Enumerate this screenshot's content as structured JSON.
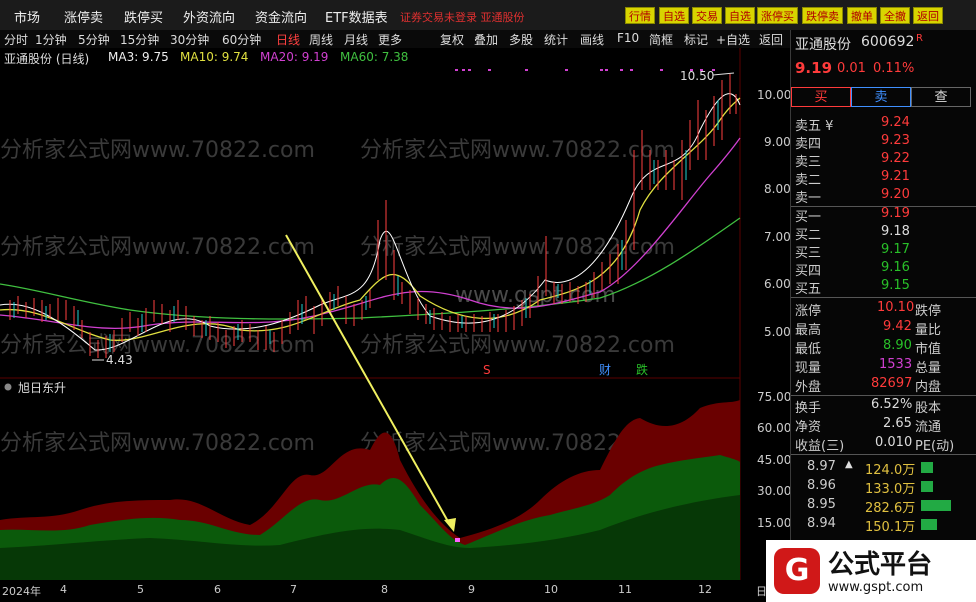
{
  "menu": [
    "市场",
    "涨停卖",
    "跌停买",
    "外资流向",
    "资金流向",
    "ETF数据表"
  ],
  "warn_text": "证券交易未登录  亚通股份",
  "top_buttons": [
    "行情",
    "自选",
    "交易",
    "自选",
    "涨停买",
    "跌停卖",
    "撤单",
    "全撤",
    "返回"
  ],
  "toolbar": {
    "periods": [
      "分时",
      "1分钟",
      "5分钟",
      "15分钟",
      "30分钟",
      "60分钟",
      "日线",
      "周线",
      "月线",
      "更多"
    ],
    "actions": [
      "复权",
      "叠加",
      "多股",
      "统计",
      "画线",
      "F10",
      "简框",
      "标记",
      "+自选",
      "返回"
    ]
  },
  "legend": {
    "title": "亚通股份 (日线)",
    "ma3": "MA3: 9.75",
    "ma10": "MA10: 9.74",
    "ma20": "MA20: 9.19",
    "ma60": "MA60: 7.38"
  },
  "price_axis": [
    "10.00",
    "9.00",
    "8.00",
    "7.00",
    "6.00",
    "5.00"
  ],
  "price_annotations": {
    "high": "10.50",
    "low": "4.43"
  },
  "event_marks": {
    "s": "S",
    "cai": "财",
    "die": "跌"
  },
  "watermark": "分析家公式网www.70822.com",
  "watermark2": "www.gspt.com",
  "indicator": {
    "name": "旭日东升",
    "axis": [
      "75.00",
      "60.00",
      "45.00",
      "30.00",
      "15.00"
    ]
  },
  "x_axis": {
    "year": "2024年",
    "months": [
      "4",
      "5",
      "6",
      "7",
      "8",
      "9",
      "10",
      "11",
      "12"
    ],
    "suffix": "日"
  },
  "stock": {
    "name": "亚通股份",
    "code": "600692",
    "flag": "R",
    "price": "9.19",
    "change": "0.01",
    "pct": "0.11%"
  },
  "trade_buttons": {
    "buy": "买",
    "sell": "卖",
    "query": "查"
  },
  "order_book": {
    "asks": [
      {
        "l": "卖五 ¥",
        "v": "9.24"
      },
      {
        "l": "卖四",
        "v": "9.23"
      },
      {
        "l": "卖三",
        "v": "9.22"
      },
      {
        "l": "卖二",
        "v": "9.21"
      },
      {
        "l": "卖一",
        "v": "9.20"
      }
    ],
    "bids": [
      {
        "l": "买一",
        "v": "9.19"
      },
      {
        "l": "买二",
        "v": "9.18"
      },
      {
        "l": "买三",
        "v": "9.17"
      },
      {
        "l": "买四",
        "v": "9.16"
      },
      {
        "l": "买五",
        "v": "9.15"
      }
    ]
  },
  "stats": [
    {
      "l": "涨停",
      "v": "10.10",
      "r": "跌停"
    },
    {
      "l": "最高",
      "v": "9.42",
      "r": "量比"
    },
    {
      "l": "最低",
      "v": "8.90",
      "r": "市值"
    },
    {
      "l": "现量",
      "v": "1533",
      "r": "总量"
    },
    {
      "l": "外盘",
      "v": "82697",
      "r": "内盘"
    },
    {
      "l": "换手",
      "v": "6.52%",
      "r": "股本"
    },
    {
      "l": "净资",
      "v": "2.65",
      "r": "流通"
    },
    {
      "l": "收益(三)",
      "v": "0.010",
      "r": "PE(动)"
    }
  ],
  "trades": [
    {
      "p": "8.97",
      "vol": "124.0万"
    },
    {
      "p": "8.96",
      "vol": "133.0万"
    },
    {
      "p": "8.95",
      "vol": "282.6万"
    },
    {
      "p": "8.94",
      "vol": "150.1万"
    }
  ],
  "logo": {
    "text": "公式平台",
    "url": "www.gspt.com"
  },
  "colors": {
    "up": "#ff3b3b",
    "down": "#29c029",
    "ma3": "#ffffff",
    "ma10": "#e0e040",
    "ma20": "#d040d0",
    "ma60": "#40c040",
    "btn": "#d8d400"
  }
}
